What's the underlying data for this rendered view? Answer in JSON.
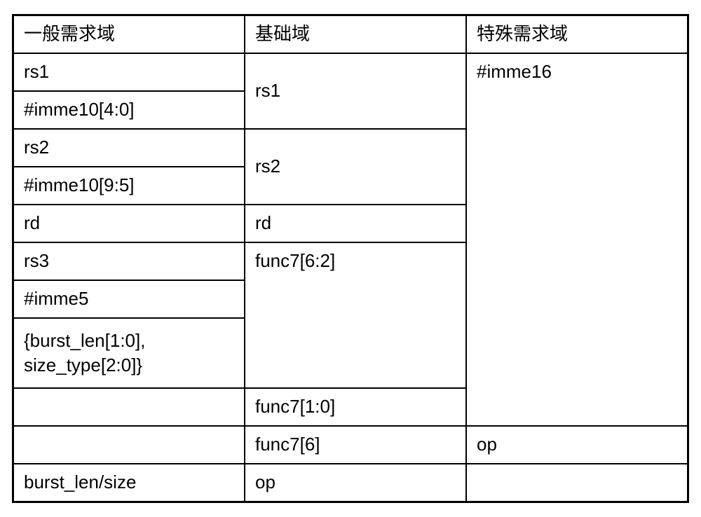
{
  "headers": {
    "col1": "一般需求域",
    "col2": "基础域",
    "col3": "特殊需求域"
  },
  "col1": {
    "r1": "rs1",
    "r2": "#imme10[4:0]",
    "r3": "rs2",
    "r4": "#imme10[9:5]",
    "r5": "rd",
    "r6": "rs3",
    "r7": "#imme5",
    "r8": "{burst_len[1:0], size_type[2:0]}",
    "r9": "",
    "r10": "",
    "r11": "burst_len/size"
  },
  "col2": {
    "r1": "rs1",
    "r2": "rs2",
    "r3": "rd",
    "r4": "func7[6:2]",
    "r5": "func7[1:0]",
    "r6": "func7[6]",
    "r7": "op"
  },
  "col3": {
    "r1": "#imme16",
    "r2": "op",
    "r3": ""
  }
}
